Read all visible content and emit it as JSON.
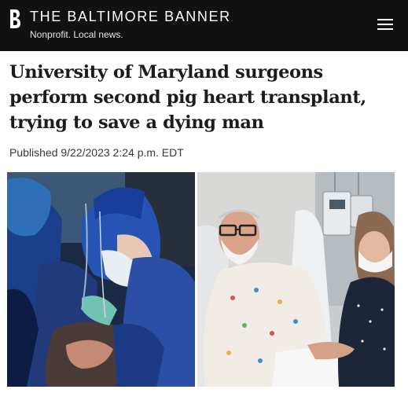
{
  "masthead": {
    "brand": "THE BALTIMORE BANNER",
    "tagline": "Nonprofit. Local news.",
    "logo_icon": "banner-b-logo-icon",
    "menu_icon": "hamburger-menu-icon"
  },
  "article": {
    "headline": "University of Maryland surgeons perform second pig heart transplant, trying to save a dying man",
    "published": "Published 9/22/2023 2:24 p.m. EDT"
  },
  "colors": {
    "header_bg": "#111111",
    "header_text": "#ffffff",
    "headline_text": "#1c1c1c",
    "byline_text": "#3a3a3a"
  }
}
